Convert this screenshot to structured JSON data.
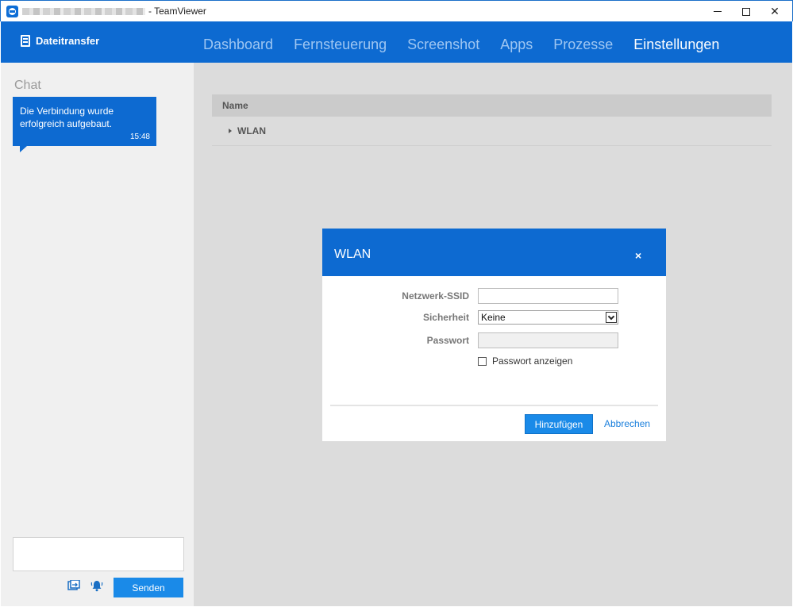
{
  "window": {
    "title_suffix": "- TeamViewer",
    "controls": {
      "minimize": "minimize-icon",
      "maximize": "maximize-icon",
      "close": "✕"
    }
  },
  "header": {
    "file_transfer": "Dateitransfer",
    "tabs": [
      {
        "label": "Dashboard",
        "active": false
      },
      {
        "label": "Fernsteuerung",
        "active": false
      },
      {
        "label": "Screenshot",
        "active": false
      },
      {
        "label": "Apps",
        "active": false
      },
      {
        "label": "Prozesse",
        "active": false
      },
      {
        "label": "Einstellungen",
        "active": true
      }
    ]
  },
  "chat": {
    "title": "Chat",
    "messages": [
      {
        "text": "Die Verbindung wurde erfolgreich aufgebaut.",
        "time": "15:48"
      }
    ],
    "input_value": "",
    "send_label": "Senden"
  },
  "table": {
    "header": "Name",
    "rows": [
      {
        "label": "WLAN"
      }
    ]
  },
  "dialog": {
    "title": "WLAN",
    "close": "×",
    "ssid_label": "Netzwerk-SSID",
    "ssid_value": "",
    "security_label": "Sicherheit",
    "security_value": "Keine",
    "password_label": "Passwort",
    "password_value": "",
    "show_password_label": "Passwort anzeigen",
    "add_label": "Hinzufügen",
    "cancel_label": "Abbrechen"
  },
  "colors": {
    "brand_blue": "#0d6ad1",
    "button_blue": "#1a8ae8",
    "nav_inactive": "#9ec6f2",
    "content_bg": "#dcdcdc"
  }
}
